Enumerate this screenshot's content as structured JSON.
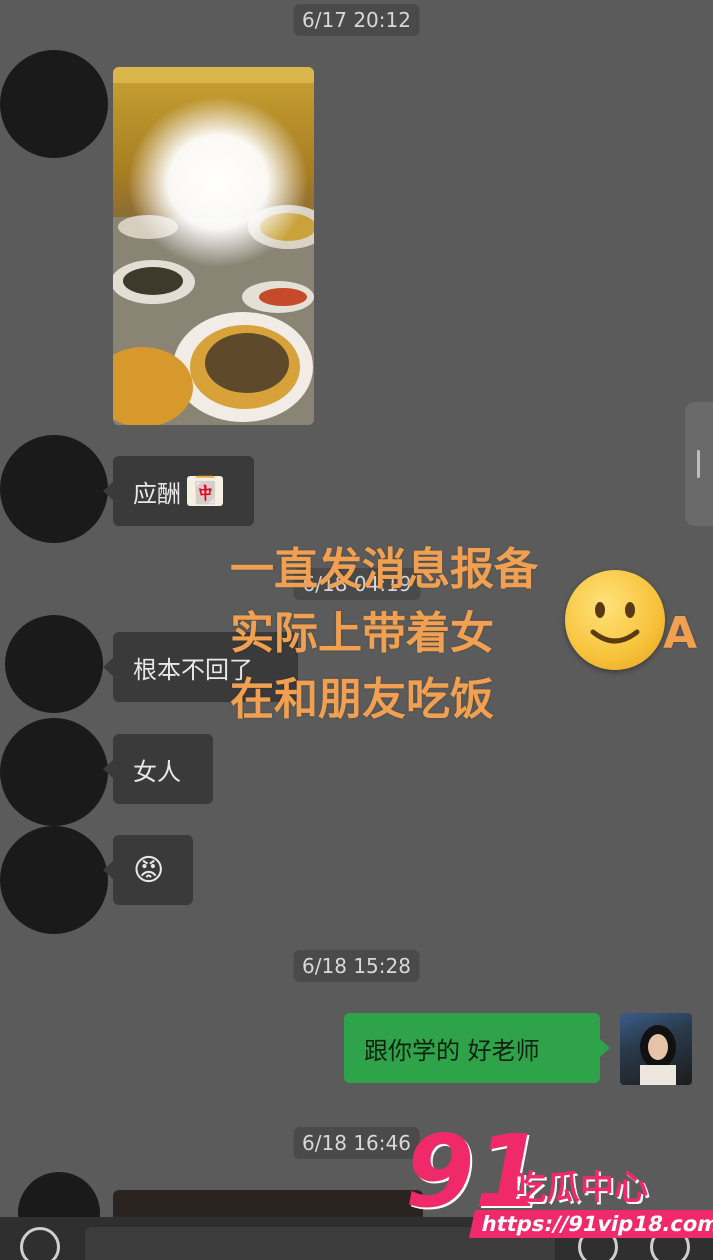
{
  "chat": {
    "timestamps": [
      "6/17 20:12",
      "6/18 04:19",
      "6/18 15:28",
      "6/18 16:46"
    ],
    "messages": {
      "m1": "应酬",
      "m1_icon": "🀄",
      "m2": "根本不回了",
      "m3": "女人",
      "m4_emoji": "😡",
      "m5": "跟你学的 好老师"
    }
  },
  "overlay": {
    "line1": "一直发消息报备",
    "line2a": "实际上带着女",
    "line2b": "A",
    "line3": "在和朋友吃饭",
    "smiley": "🙂"
  },
  "watermark": {
    "number": "91",
    "name": "吃瓜中心",
    "url": "https://91vip18.com"
  },
  "colors": {
    "background": "#5b5b5b",
    "bubble_incoming": "#3a3a3a",
    "bubble_outgoing": "#2ea34a",
    "overlay_text": "#f0a050",
    "watermark": "#f02a6a"
  }
}
